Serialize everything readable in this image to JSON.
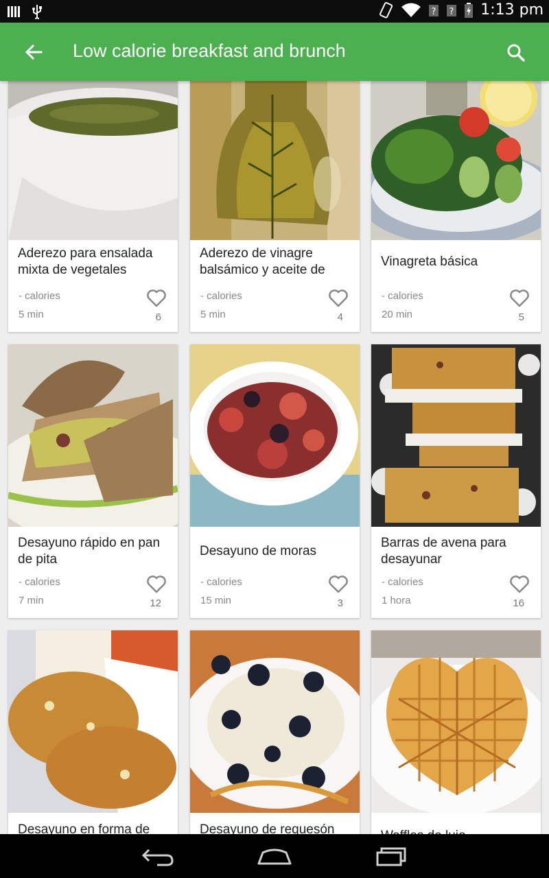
{
  "status_bar": {
    "time": "1:13 pm",
    "icons": [
      "signal-bars-icon",
      "usb-icon",
      "rotation-icon",
      "wifi-icon",
      "unknown-icon",
      "unknown-icon",
      "battery-icon"
    ]
  },
  "app_bar": {
    "title": "Low calorie breakfast and brunch",
    "back_icon": "arrow-left-icon",
    "search_icon": "search-icon",
    "color": "#4caf50"
  },
  "recipes": [
    {
      "title": "Aderezo para ensalada mixta de vegetales",
      "calories": "- calories",
      "time": "5 min",
      "likes": "6",
      "image": "creamy-green-soup-bowl"
    },
    {
      "title": "Aderezo de vinagre balsámico y aceite de",
      "calories": "- calories",
      "time": "5 min",
      "likes": "4",
      "image": "herb-oil-bottle"
    },
    {
      "title": "Vinagreta básica",
      "calories": "- calories",
      "time": "20 min",
      "likes": "5",
      "image": "green-salad-plate"
    },
    {
      "title": "Desayuno rápido en pan de pita",
      "calories": "- calories",
      "time": "7 min",
      "likes": "12",
      "image": "stuffed-pita"
    },
    {
      "title": "Desayuno de moras",
      "calories": "- calories",
      "time": "15 min",
      "likes": "3",
      "image": "berries-bowl"
    },
    {
      "title": "Barras de avena para desayunar",
      "calories": "- calories",
      "time": "1 hora",
      "likes": "16",
      "image": "oat-bars-stack"
    },
    {
      "title": "Desayuno en forma de",
      "calories": "",
      "time": "",
      "likes": "",
      "image": "oat-cookies-milk"
    },
    {
      "title": "Desayuno de requesón",
      "calories": "",
      "time": "",
      "likes": "",
      "image": "cottage-cheese-blueberries"
    },
    {
      "title": "Waffles de lujo",
      "calories": "",
      "time": "",
      "likes": "",
      "image": "heart-waffle"
    }
  ],
  "nav_bar": {
    "back_icon": "nav-back-icon",
    "home_icon": "nav-home-icon",
    "recents_icon": "nav-recents-icon"
  }
}
